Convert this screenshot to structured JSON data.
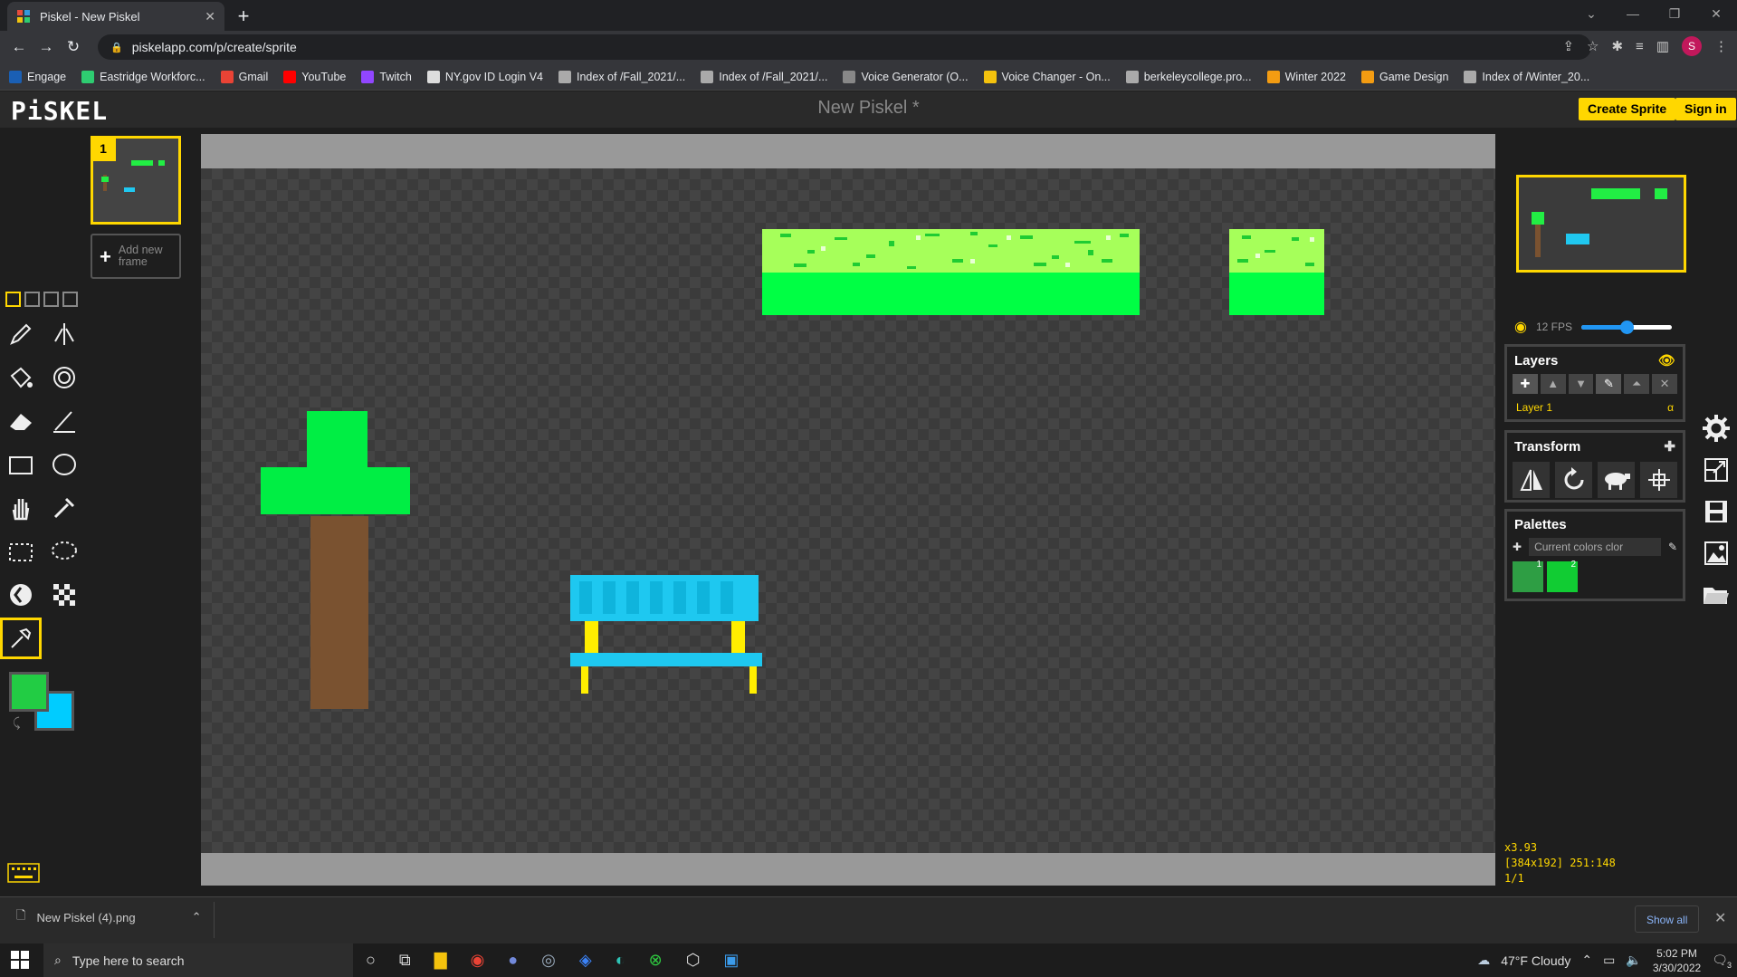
{
  "browser": {
    "tab_title": "Piskel - New Piskel",
    "url": "piskelapp.com/p/create/sprite",
    "bookmarks": [
      {
        "label": "Engage",
        "color": "#1a5fb4"
      },
      {
        "label": "Eastridge Workforc...",
        "color": "#2ecc71"
      },
      {
        "label": "Gmail",
        "color": "#ea4335"
      },
      {
        "label": "YouTube",
        "color": "#ff0000"
      },
      {
        "label": "Twitch",
        "color": "#9146ff"
      },
      {
        "label": "NY.gov ID Login V4",
        "color": "#dddddd"
      },
      {
        "label": "Index of /Fall_2021/...",
        "color": "#aaaaaa"
      },
      {
        "label": "Index of /Fall_2021/...",
        "color": "#aaaaaa"
      },
      {
        "label": "Voice Generator (O...",
        "color": "#888888"
      },
      {
        "label": "Voice Changer - On...",
        "color": "#f4c20d"
      },
      {
        "label": "berkeleycollege.pro...",
        "color": "#aaaaaa"
      },
      {
        "label": "Winter 2022",
        "color": "#f39c12"
      },
      {
        "label": "Game Design",
        "color": "#f39c12"
      },
      {
        "label": "Index of /Winter_20...",
        "color": "#aaaaaa"
      }
    ],
    "avatar_letter": "S"
  },
  "app": {
    "logo": "PiSKEL",
    "title": "New Piskel *",
    "create_sprite": "Create Sprite",
    "sign_in": "Sign in",
    "accent": "#ffd700"
  },
  "frames": {
    "current": "1",
    "add_line1": "Add new",
    "add_line2": "frame"
  },
  "tools": [
    "pen-icon",
    "vertical-mirror-pen-icon",
    "paint-bucket-icon",
    "paint-all-similar-icon",
    "eraser-icon",
    "stroke-icon",
    "rectangle-icon",
    "circle-icon",
    "move-icon",
    "shape-select-icon",
    "rect-select-icon",
    "lasso-select-icon",
    "lighten-icon",
    "dithering-icon",
    "color-picker-icon"
  ],
  "colors": {
    "primary": "#22cc44",
    "secondary": "#00ccff"
  },
  "right": {
    "fps": "12 FPS",
    "fps_fraction": 0.5,
    "layers_title": "Layers",
    "layer_name": "Layer 1",
    "layer_alpha": "α",
    "transform_title": "Transform",
    "palettes_title": "Palettes",
    "palette_select": "Current colors clor",
    "palette_colors": [
      {
        "hex": "#2e9e44",
        "num": "1"
      },
      {
        "hex": "#11cc33",
        "num": "2"
      }
    ]
  },
  "status": {
    "zoom": "x3.93",
    "coords": "[384x192] 251:148",
    "frames": "1/1"
  },
  "downloads": {
    "file": "New Piskel (4).png",
    "show_all": "Show all"
  },
  "taskbar": {
    "search_placeholder": "Type here to search",
    "weather": "47°F  Cloudy",
    "time": "5:02 PM",
    "date": "3/30/2022",
    "notifications": "3"
  }
}
